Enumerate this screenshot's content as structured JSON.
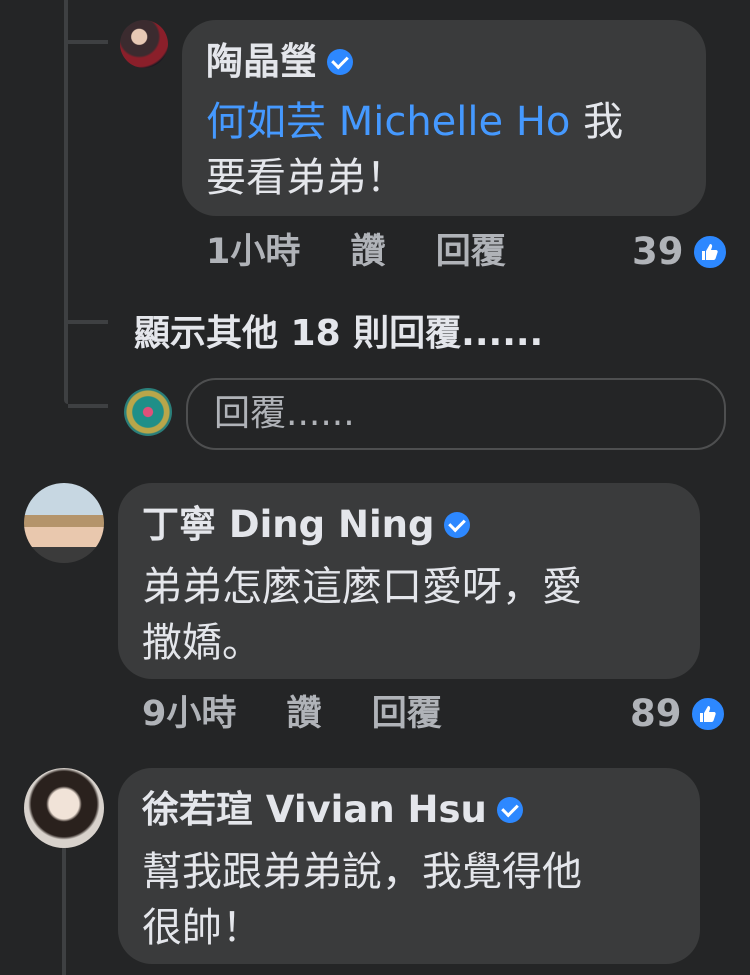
{
  "comments": [
    {
      "author": "陶晶瑩",
      "verified": true,
      "mention": "何如芸 Michelle Ho",
      "text_line1_suffix": " 我",
      "text_line2": "要看弟弟！",
      "time": "1小時",
      "like_label": "讚",
      "reply_label": "回覆",
      "likes": "39"
    },
    {
      "author": "丁寧 Ding Ning",
      "verified": true,
      "text_line1": "弟弟怎麼這麼口愛呀，愛",
      "text_line2": "撒嬌。",
      "time": "9小時",
      "like_label": "讚",
      "reply_label": "回覆",
      "likes": "89"
    },
    {
      "author": "徐若瑄 Vivian Hsu",
      "verified": true,
      "text_line1": "幫我跟弟弟說，我覺得他",
      "text_line2": "很帥！"
    }
  ],
  "more_replies": "顯示其他 18 則回覆......",
  "reply_input": {
    "placeholder": "回覆......"
  },
  "colors": {
    "background": "#242526",
    "bubble": "#3a3b3c",
    "mention": "#4599ff",
    "verified": "#2d88ff",
    "meta": "#b0b3b8"
  },
  "icons": [
    "verified-badge-icon",
    "like-thumb-icon"
  ]
}
